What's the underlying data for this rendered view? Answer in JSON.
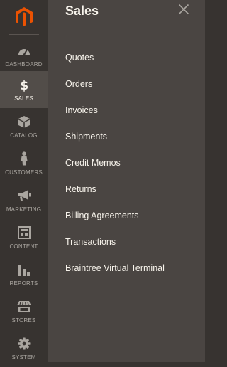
{
  "nav": {
    "items": [
      {
        "label": "Dashboard",
        "icon": "dashboard-icon"
      },
      {
        "label": "Sales",
        "icon": "dollar-icon",
        "active": true
      },
      {
        "label": "Catalog",
        "icon": "catalog-box-icon"
      },
      {
        "label": "Customers",
        "icon": "customer-person-icon"
      },
      {
        "label": "Marketing",
        "icon": "megaphone-icon"
      },
      {
        "label": "Content",
        "icon": "content-layout-icon"
      },
      {
        "label": "Reports",
        "icon": "bar-chart-icon"
      },
      {
        "label": "Stores",
        "icon": "storefront-icon"
      },
      {
        "label": "System",
        "icon": "gear-icon"
      }
    ]
  },
  "panel": {
    "title": "Sales",
    "items": [
      "Quotes",
      "Orders",
      "Invoices",
      "Shipments",
      "Credit Memos",
      "Returns",
      "Billing Agreements",
      "Transactions",
      "Braintree Virtual Terminal"
    ]
  },
  "colors": {
    "rail_bg": "#373330",
    "rail_active_bg": "#524d49",
    "panel_bg": "#4a4542",
    "brand_orange": "#eb5202",
    "text_light": "#f7f3eb",
    "text_muted": "#aaa6a0"
  }
}
